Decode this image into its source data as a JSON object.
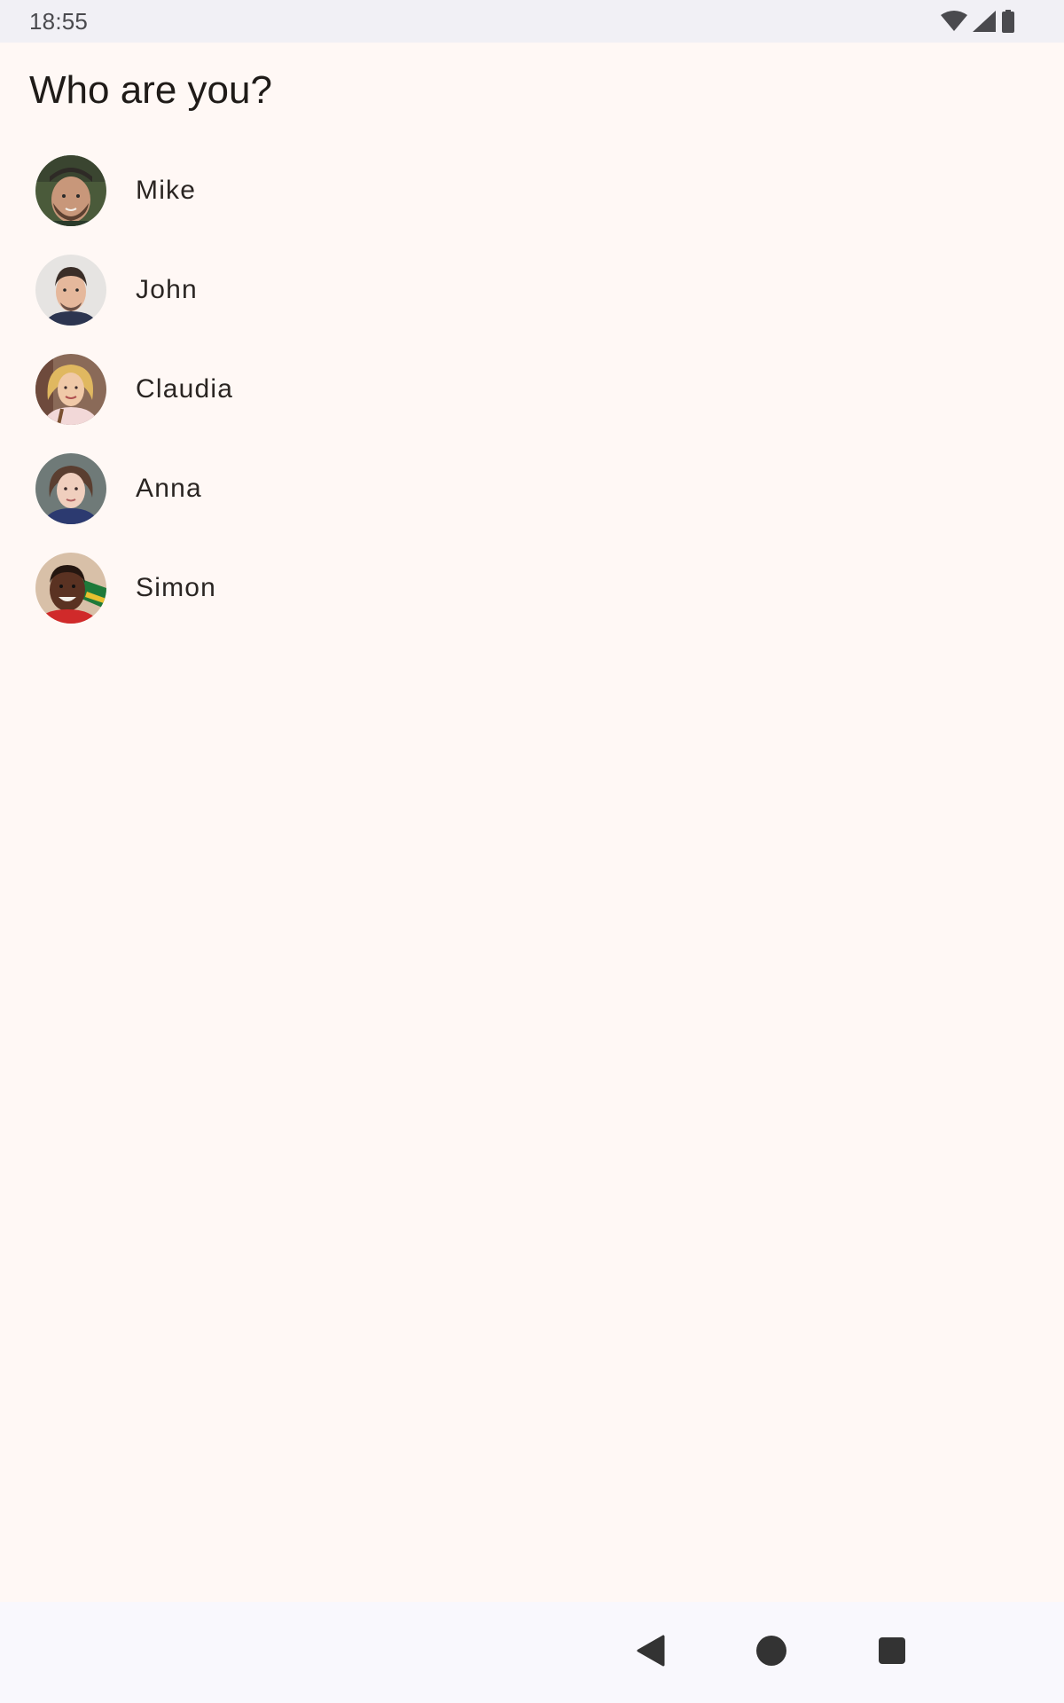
{
  "status_bar": {
    "time": "18:55",
    "icons": [
      "wifi-icon",
      "cellular-signal-icon",
      "battery-icon"
    ]
  },
  "page": {
    "title": "Who are you?"
  },
  "users": [
    {
      "name": "Mike"
    },
    {
      "name": "John"
    },
    {
      "name": "Claudia"
    },
    {
      "name": "Anna"
    },
    {
      "name": "Simon"
    }
  ],
  "nav_bar": {
    "buttons": [
      "back-icon",
      "home-icon",
      "recents-icon"
    ]
  },
  "colors": {
    "background": "#fff8f5",
    "status_bar": "#f1f0f5",
    "nav_bar": "#f9f8fd",
    "text": "#1f1b18",
    "icon": "#333333"
  }
}
